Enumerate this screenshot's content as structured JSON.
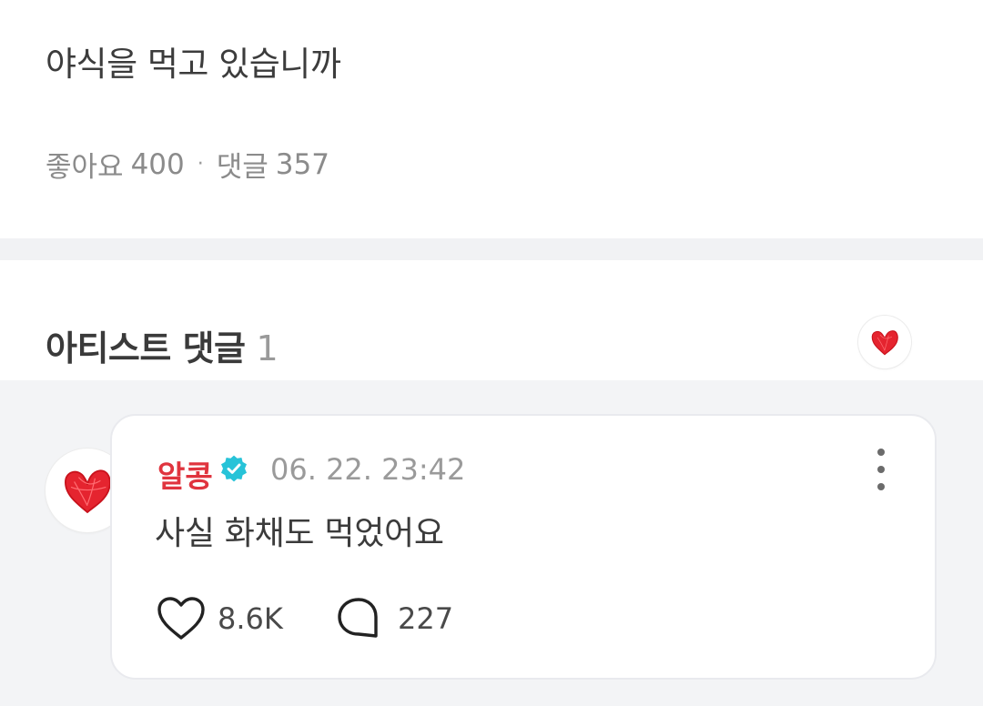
{
  "post": {
    "title": "야식을 먹고 있습니까",
    "likes_label": "좋아요",
    "likes_count": "400",
    "separator": "·",
    "comments_label": "댓글",
    "comments_count": "357"
  },
  "artist_comments": {
    "header": "아티스트 댓글",
    "count": "1",
    "accent_color": "#e0343e",
    "comment": {
      "author": "알콩",
      "verified_icon": "verified-badge-icon",
      "timestamp": "06. 22. 23:42",
      "text": "사실 화채도 먹었어요",
      "like_count": "8.6K",
      "reply_count": "227"
    }
  }
}
